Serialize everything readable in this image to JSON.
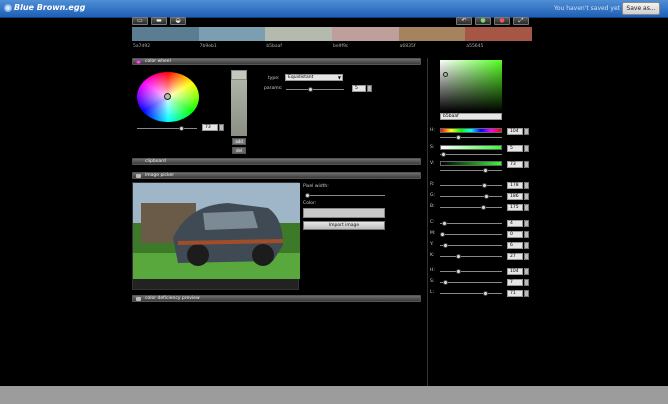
{
  "app": {
    "title": "Blue Brown.egg",
    "save_status": "You haven't saved yet",
    "save_as_label": "Save as..."
  },
  "toolbar_left_icons": [
    "new-icon",
    "open-folder-icon",
    "folder-icon"
  ],
  "toolbar_right_icons": [
    "undo-icon",
    "redo-icon",
    "palette-icon",
    "settings-icon",
    "fullscreen-icon"
  ],
  "palette": [
    {
      "hex": "5a7d92",
      "color": "#5a7d92"
    },
    {
      "hex": "7b9eb1",
      "color": "#7b9eb1"
    },
    {
      "hex": "b5baaf",
      "color": "#b5baaf"
    },
    {
      "hex": "be9f9c",
      "color": "#be9f9c"
    },
    {
      "hex": "a6835f",
      "color": "#a6835f"
    },
    {
      "hex": "a55645",
      "color": "#a55645"
    }
  ],
  "color_wheel": {
    "title": "color wheel",
    "type_label": "type:",
    "type_value": "Equidistant",
    "params_label": "params:",
    "params_value": "5",
    "brightness_value": "73",
    "add_label": "add",
    "remove_label": "del"
  },
  "clipboard": {
    "title": "clipboard"
  },
  "image_picker": {
    "title": "image picker",
    "pixel_width_label": "Pixel width:",
    "color_label": "Color:",
    "import_label": "Import image"
  },
  "color_deficiency": {
    "title": "color deficiency preview"
  },
  "selected_color": {
    "hex": "b5baaf"
  },
  "hsv": [
    {
      "label": "H:",
      "value": "104"
    },
    {
      "label": "S:",
      "value": "5"
    },
    {
      "label": "V:",
      "value": "73"
    }
  ],
  "rgb": [
    {
      "label": "R:",
      "value": "178"
    },
    {
      "label": "G:",
      "value": "186"
    },
    {
      "label": "B:",
      "value": "175"
    }
  ],
  "cmyk": [
    {
      "label": "C:",
      "value": "4"
    },
    {
      "label": "M:",
      "value": "0"
    },
    {
      "label": "Y:",
      "value": "6"
    },
    {
      "label": "K:",
      "value": "27"
    }
  ],
  "hsl": [
    {
      "label": "H:",
      "value": "104"
    },
    {
      "label": "S:",
      "value": "7"
    },
    {
      "label": "L:",
      "value": "71"
    }
  ],
  "colors": {
    "titlebar": "#2f6fc4",
    "panel_bg": "#000000",
    "accent": "#3a3a3a"
  }
}
